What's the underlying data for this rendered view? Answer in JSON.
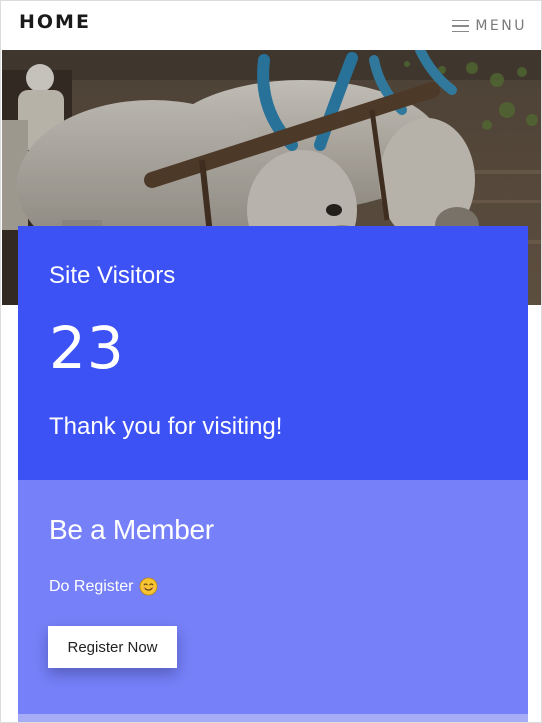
{
  "header": {
    "home_label": "HOME",
    "menu_label": "MENU",
    "menu_icon": "hamburger-icon"
  },
  "hero": {
    "image_desc": "oxen-plowing-photo"
  },
  "visitors": {
    "title": "Site Visitors",
    "count": "23",
    "message": "Thank you for visiting!",
    "bg_color": "#3d52f4"
  },
  "member": {
    "title": "Be a Member",
    "text": "Do Register",
    "emoji_icon": "smiling-face-icon",
    "button_label": "Register Now",
    "bg_color": "#7680f8"
  }
}
